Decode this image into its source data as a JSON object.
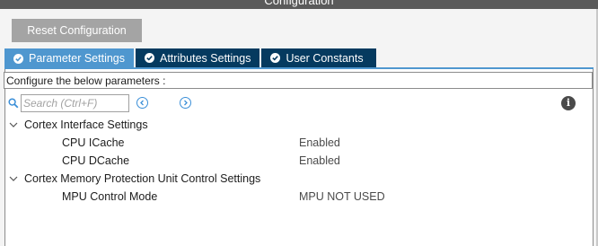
{
  "window": {
    "title": "Configuration"
  },
  "toolbar": {
    "reset_label": "Reset Configuration"
  },
  "tabs": [
    {
      "label": "Parameter Settings",
      "active": true
    },
    {
      "label": "Attributes Settings",
      "active": false
    },
    {
      "label": "User Constants",
      "active": false
    }
  ],
  "description": "Configure the below parameters :",
  "search": {
    "placeholder": "Search (Ctrl+F)"
  },
  "groups": [
    {
      "label": "Cortex Interface Settings",
      "expanded": true,
      "params": [
        {
          "name": "CPU ICache",
          "value": "Enabled"
        },
        {
          "name": "CPU DCache",
          "value": "Enabled"
        }
      ]
    },
    {
      "label": "Cortex Memory Protection Unit Control Settings",
      "expanded": true,
      "params": [
        {
          "name": "MPU Control Mode",
          "value": "MPU NOT USED"
        }
      ]
    }
  ],
  "colors": {
    "tab_active": "#4f97cf",
    "tab_inactive": "#053a5f",
    "reset_button": "#a4a4a4",
    "nav_arrow": "#3b8fd8"
  },
  "icons": {
    "search": "search-icon",
    "prev": "chevron-left-icon",
    "next": "chevron-right-icon",
    "info": "info-icon",
    "expand": "chevron-down-icon",
    "tab_check": "check-circle-icon"
  }
}
